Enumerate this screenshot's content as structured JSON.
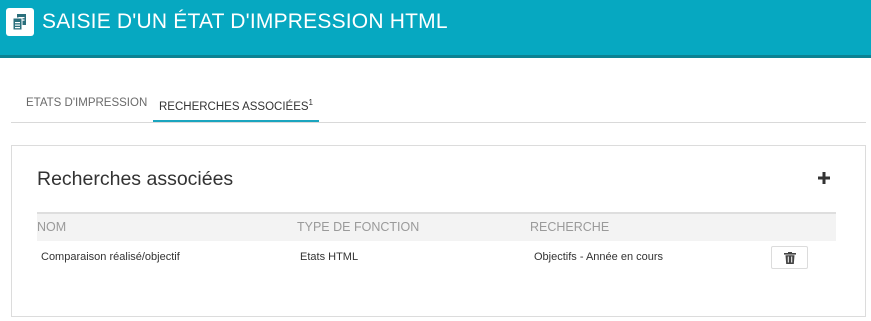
{
  "header": {
    "title": "SAISIE D'UN ÉTAT D'IMPRESSION HTML",
    "icon": "copy-documents-icon",
    "background_color": "#06a8c1"
  },
  "tabs": [
    {
      "label": "ETATS D'IMPRESSION",
      "active": false
    },
    {
      "label": "RECHERCHES ASSOCIÉES",
      "badge": "1",
      "active": true
    }
  ],
  "panel": {
    "title": "Recherches associées",
    "add_icon": "plus-icon",
    "columns": [
      "NOM",
      "TYPE DE FONCTION",
      "RECHERCHE"
    ],
    "rows": [
      {
        "nom": "Comparaison réalisé/objectif",
        "type": "Etats HTML",
        "recherche": "Objectifs - Année en cours",
        "action_icon": "trash-icon"
      }
    ]
  },
  "colors": {
    "accent": "#1ba5bf"
  }
}
